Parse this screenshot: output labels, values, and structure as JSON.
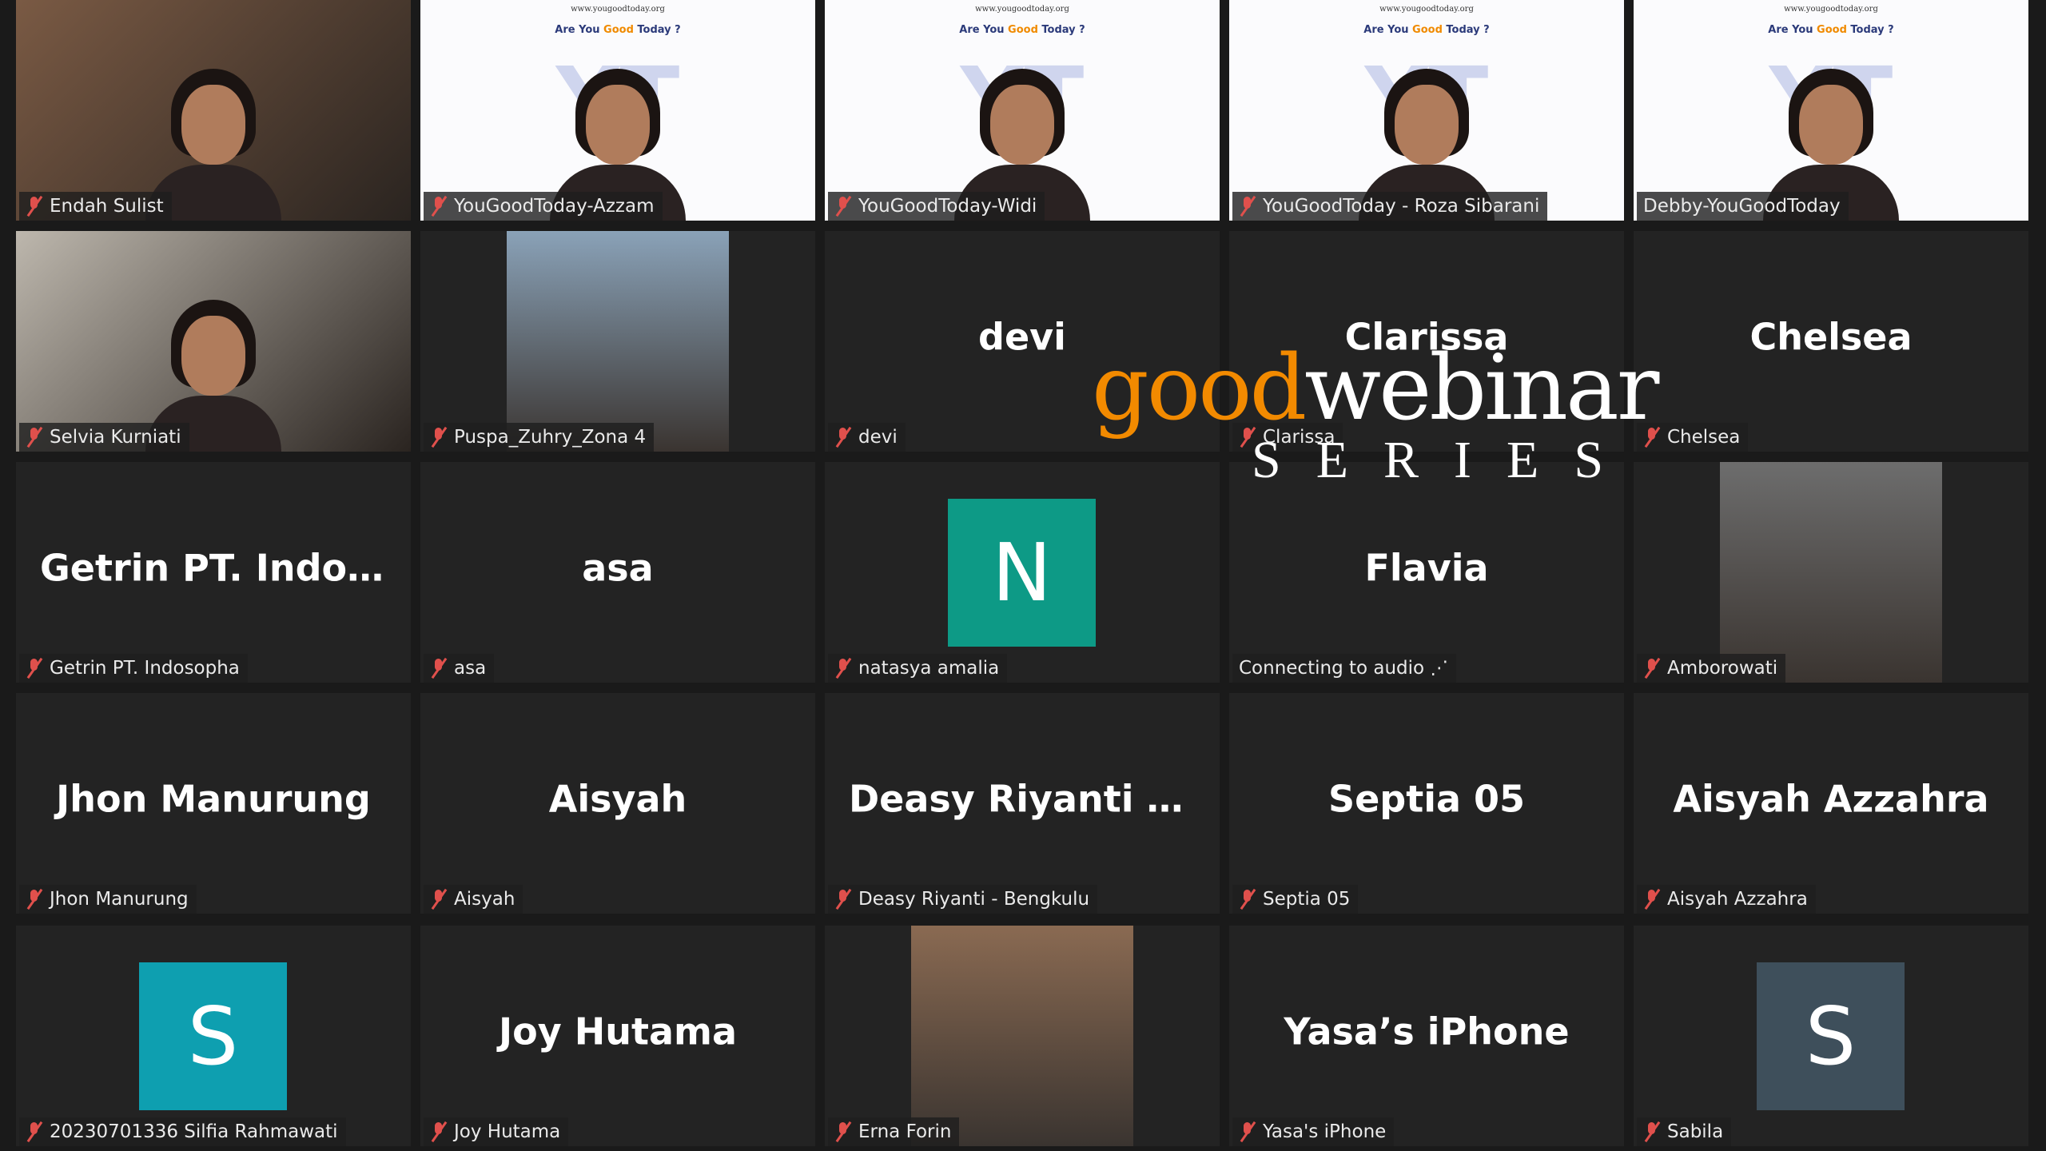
{
  "meeting": {
    "active_speaker_color": "#c9e24c",
    "muted_icon": "mic-muted-icon",
    "participants": [
      {
        "label": "Endah Sulist",
        "type": "video",
        "bg": "#7a5a44",
        "muted": true
      },
      {
        "label": "YouGoodToday-Azzam",
        "type": "slide",
        "muted": true
      },
      {
        "label": "YouGoodToday-Widi",
        "type": "slide",
        "muted": true
      },
      {
        "label": "YouGoodToday - Roza Sibarani",
        "type": "slide",
        "muted": true
      },
      {
        "label": "Debby-YouGoodToday",
        "type": "slide",
        "muted": false,
        "active": true
      },
      {
        "label": "Selvia Kurniati",
        "type": "video",
        "bg": "#bdb7ad",
        "muted": true
      },
      {
        "label": "Puspa_Zuhry_Zona 4",
        "type": "photo",
        "bg": "#8aa2b8",
        "muted": true
      },
      {
        "label": "devi",
        "name": "devi",
        "type": "name",
        "muted": true
      },
      {
        "label": "Clarissa",
        "name": "Clarissa",
        "type": "name",
        "muted": true
      },
      {
        "label": "Chelsea",
        "name": "Chelsea",
        "type": "name",
        "muted": true
      },
      {
        "label": "Getrin PT. Indosopha",
        "name": "Getrin PT. Indos...",
        "type": "name",
        "muted": true
      },
      {
        "label": "asa",
        "name": "asa",
        "type": "name",
        "muted": true
      },
      {
        "label": "natasya amalia",
        "avatar": "N",
        "avatar_color": "#0d9a86",
        "type": "avatar",
        "muted": true
      },
      {
        "label": "Connecting to audio ⋰",
        "name": "Flavia",
        "type": "name",
        "muted": false
      },
      {
        "label": "Amborowati",
        "type": "photo",
        "bg": "#6d6d6d",
        "muted": true
      },
      {
        "label": "Jhon Manurung",
        "name": "Jhon Manurung",
        "type": "name",
        "muted": true
      },
      {
        "label": "Aisyah",
        "name": "Aisyah",
        "type": "name",
        "muted": true
      },
      {
        "label": "Deasy Riyanti - Bengkulu",
        "name": "Deasy Riyanti -...",
        "type": "name",
        "muted": true
      },
      {
        "label": "Septia 05",
        "name": "Septia 05",
        "type": "name",
        "muted": true
      },
      {
        "label": "Aisyah Azzahra",
        "name": "Aisyah Azzahra",
        "type": "name",
        "muted": true
      },
      {
        "label": "20230701336 Silfia Rahmawati",
        "avatar": "S",
        "avatar_color": "#0e9fb0",
        "type": "avatar",
        "muted": true
      },
      {
        "label": "Joy Hutama",
        "name": "Joy Hutama",
        "type": "name",
        "muted": true
      },
      {
        "label": "Erna Forin",
        "type": "photo",
        "bg": "#8a6a52",
        "muted": true
      },
      {
        "label": "Yasa's iPhone",
        "name": "Yasa’s iPhone",
        "type": "name",
        "muted": true
      },
      {
        "label": "Sabila",
        "avatar": "S",
        "avatar_color": "#3e4f5b",
        "type": "avatar",
        "muted": true
      }
    ],
    "slide": {
      "url": "www.yougoodtoday.org",
      "question_pre": "Are You ",
      "question_good": "Good",
      "question_post": " Today ?",
      "watermark": "YT"
    }
  },
  "overlay_logo": {
    "good": "good",
    "webinar": "webinar",
    "series": "SERIES"
  }
}
